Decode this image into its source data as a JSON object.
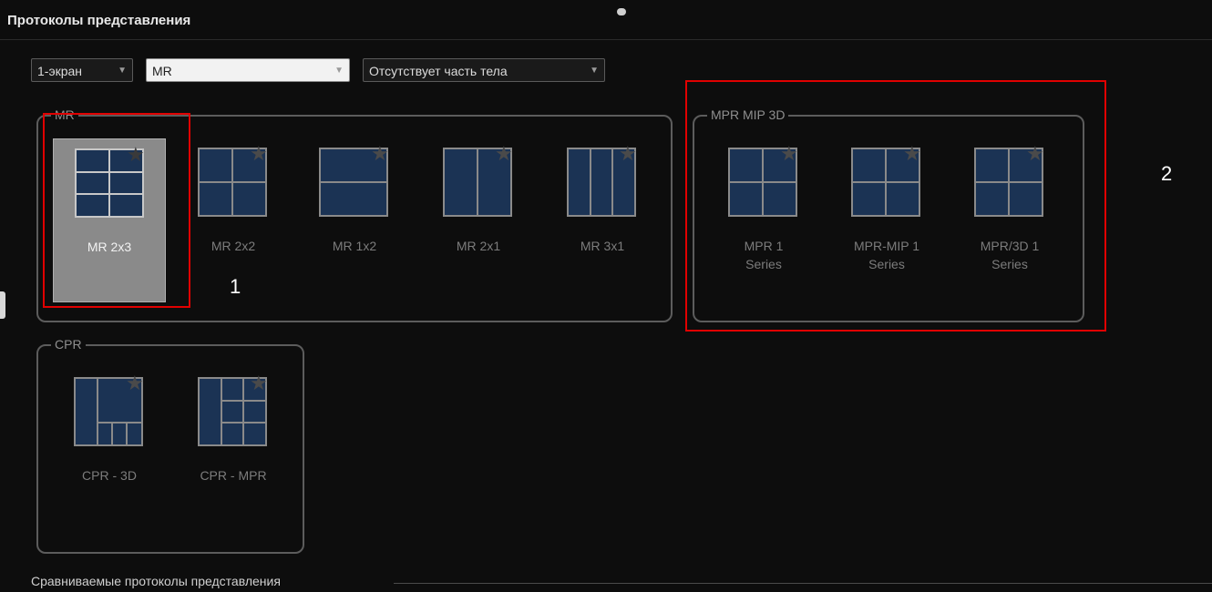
{
  "window": {
    "title": "Протоколы представления"
  },
  "toolbar": {
    "screen_select": "1-экран",
    "modality_select": "MR",
    "bodypart_select": "Отсутствует часть тела"
  },
  "groups": {
    "mr": {
      "label": "MR",
      "tiles": [
        "MR 2x3",
        "MR 2x2",
        "MR 1x2",
        "MR 2x1",
        "MR 3x1"
      ]
    },
    "mpr": {
      "label": "MPR MIP 3D",
      "tiles": [
        {
          "line1": "MPR 1",
          "line2": "Series"
        },
        {
          "line1": "MPR-MIP 1",
          "line2": "Series"
        },
        {
          "line1": "MPR/3D 1",
          "line2": "Series"
        }
      ]
    },
    "cpr": {
      "label": "CPR",
      "tiles": [
        "CPR - 3D",
        "CPR - MPR"
      ]
    }
  },
  "annotations": {
    "marker1": "1",
    "marker2": "2"
  },
  "footer": {
    "compare_label": "Сравниваемые протоколы представления"
  },
  "colors": {
    "accent_red": "#e00000",
    "tile_fill": "#1b3354",
    "selected_bg": "#8a8a8a"
  },
  "icons": {
    "favorite": "star-icon",
    "dropdown": "chevron-down-icon"
  }
}
